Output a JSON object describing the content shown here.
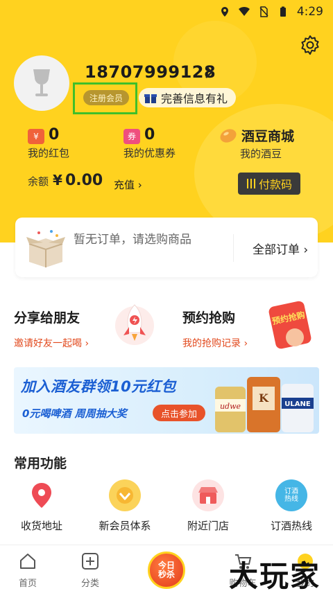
{
  "status_bar": {
    "time": "4:29"
  },
  "profile": {
    "phone": "18707999128",
    "member_tag": "注册会员",
    "perfect_info": "完善信息有礼"
  },
  "stats": {
    "red_packet": {
      "badge": "¥",
      "value": "0",
      "label": "我的红包"
    },
    "coupon": {
      "badge": "券",
      "value": "0",
      "label": "我的优惠券"
    },
    "beans": {
      "title": "酒豆商城",
      "label": "我的酒豆"
    }
  },
  "balance": {
    "label": "余额",
    "currency": "¥",
    "amount": "0.00",
    "recharge": "充值",
    "paycode": "付款码"
  },
  "orders": {
    "empty_text": "暂无订单，请选购商品",
    "all_orders": "全部订单"
  },
  "features": {
    "share": {
      "title": "分享给朋友",
      "sub": "邀请好友一起喝"
    },
    "reserve": {
      "title": "预约抢购",
      "sub": "我的抢购记录",
      "tag": "预约抢购"
    }
  },
  "banner": {
    "headline": "加入酒友群领10元红包",
    "sub": "0元喝啤酒 周周抽大奖",
    "cta": "点击参加",
    "can1": "udwe",
    "can2": "K",
    "can3": "ULANE"
  },
  "common": {
    "title": "常用功能",
    "items": [
      {
        "label": "收货地址",
        "icon": "location-pin-icon",
        "color": "#ee4b55"
      },
      {
        "label": "新会员体系",
        "icon": "member-badge-icon",
        "color": "#f7b733"
      },
      {
        "label": "附近门店",
        "icon": "store-icon",
        "color": "#ef5b5b"
      },
      {
        "label": "订酒热线",
        "icon": "hotline-icon",
        "color": "#45b6e6",
        "icon_text": "订酒热线"
      }
    ]
  },
  "tabbar": {
    "items": [
      {
        "label": "首页"
      },
      {
        "label": "分类"
      },
      {
        "label": "今日秒杀"
      },
      {
        "label": "购物车"
      },
      {
        "label": "我的"
      }
    ]
  },
  "watermark": "大玩家",
  "colors": {
    "brand_yellow": "#ffd21f",
    "accent_red": "#e24a1e",
    "highlight_green": "#3fbf2a"
  }
}
